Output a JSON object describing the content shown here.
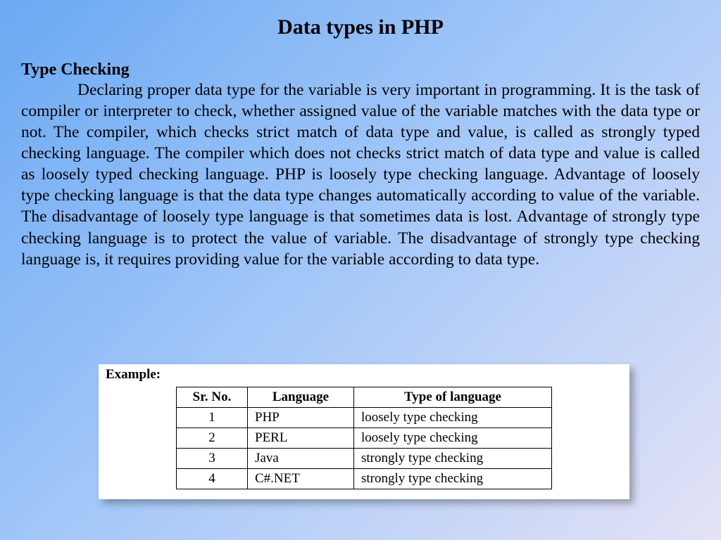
{
  "title": "Data types in PHP",
  "subtitle": "Type Checking",
  "body": "Declaring proper data type for the variable is very important in programming. It is the task of compiler or interpreter to check, whether assigned value of the variable matches with the data type or not. The compiler, which checks strict match of data type and value, is called as strongly typed checking language. The compiler which does not checks strict match of data type and value is called as loosely typed checking language. PHP is loosely type checking language. Advantage of loosely type checking language is that the data type changes automatically according to value of the variable. The disadvantage of loosely type language is that sometimes data is lost. Advantage of strongly type checking language is to protect the value of variable. The disadvantage of strongly type checking language is, it requires providing value for the variable according to data type.",
  "example_label": "Example:",
  "table": {
    "headers": {
      "sr": "Sr. No.",
      "lang": "Language",
      "type": "Type of language"
    },
    "rows": [
      {
        "sr": "1",
        "lang": "PHP",
        "type": "loosely type checking"
      },
      {
        "sr": "2",
        "lang": "PERL",
        "type": "loosely type checking"
      },
      {
        "sr": "3",
        "lang": "Java",
        "type": "strongly type checking"
      },
      {
        "sr": "4",
        "lang": "C#.NET",
        "type": "strongly type checking"
      }
    ]
  }
}
